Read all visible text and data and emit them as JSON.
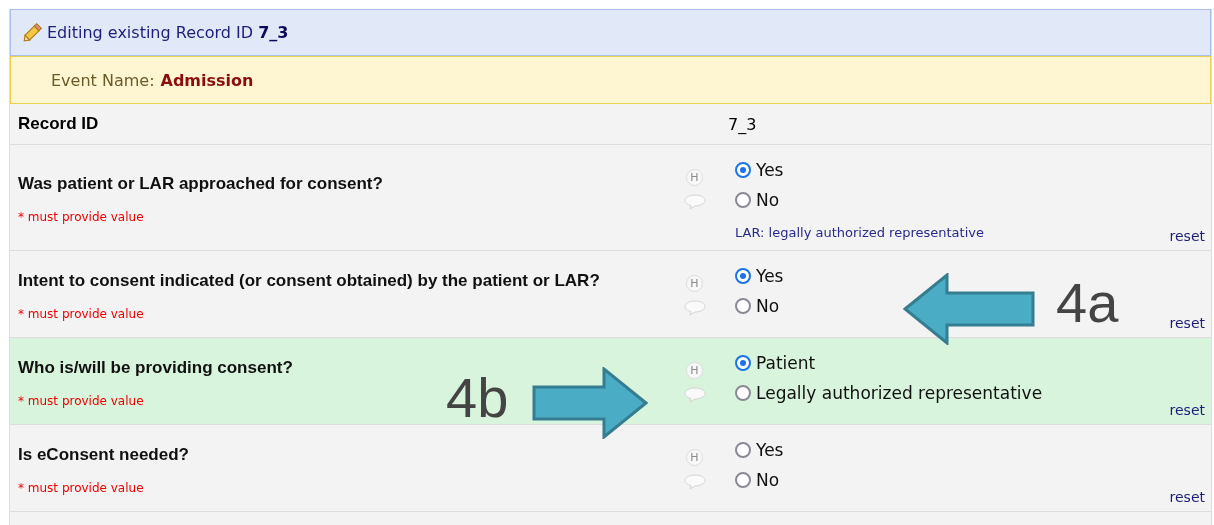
{
  "header": {
    "text": "Editing existing Record ID **7_3**"
  },
  "event": {
    "label": "Event Name:",
    "value": "Admission"
  },
  "record_id": {
    "label": "Record ID",
    "value": "7_3"
  },
  "fields": [
    {
      "question": "Was patient or LAR approached for consent?",
      "required_note": "* must provide value",
      "history_icon": "H",
      "highlighted": false,
      "options": [
        {
          "label": "Yes",
          "selected": true
        },
        {
          "label": "No",
          "selected": false
        }
      ],
      "note": "LAR: legally authorized representative",
      "reset": "reset"
    },
    {
      "question": "Intent to consent indicated (or consent obtained) by the patient or LAR?",
      "required_note": "* must provide value",
      "history_icon": "H",
      "highlighted": false,
      "options": [
        {
          "label": "Yes",
          "selected": true
        },
        {
          "label": "No",
          "selected": false
        }
      ],
      "reset": "reset"
    },
    {
      "question": "Who is/will be providing consent?",
      "required_note": "* must provide value",
      "history_icon": "H",
      "highlighted": true,
      "options": [
        {
          "label": "Patient",
          "selected": true
        },
        {
          "label": "Legally authorized representative",
          "selected": false
        }
      ],
      "reset": "reset"
    },
    {
      "question": "Is eConsent needed?",
      "required_note": "* must provide value",
      "history_icon": "H",
      "highlighted": false,
      "options": [
        {
          "label": "Yes",
          "selected": false
        },
        {
          "label": "No",
          "selected": false
        }
      ],
      "reset": "reset"
    }
  ],
  "annotations": [
    {
      "label": "4a",
      "kind": "left"
    },
    {
      "label": "4b",
      "kind": "right"
    }
  ]
}
